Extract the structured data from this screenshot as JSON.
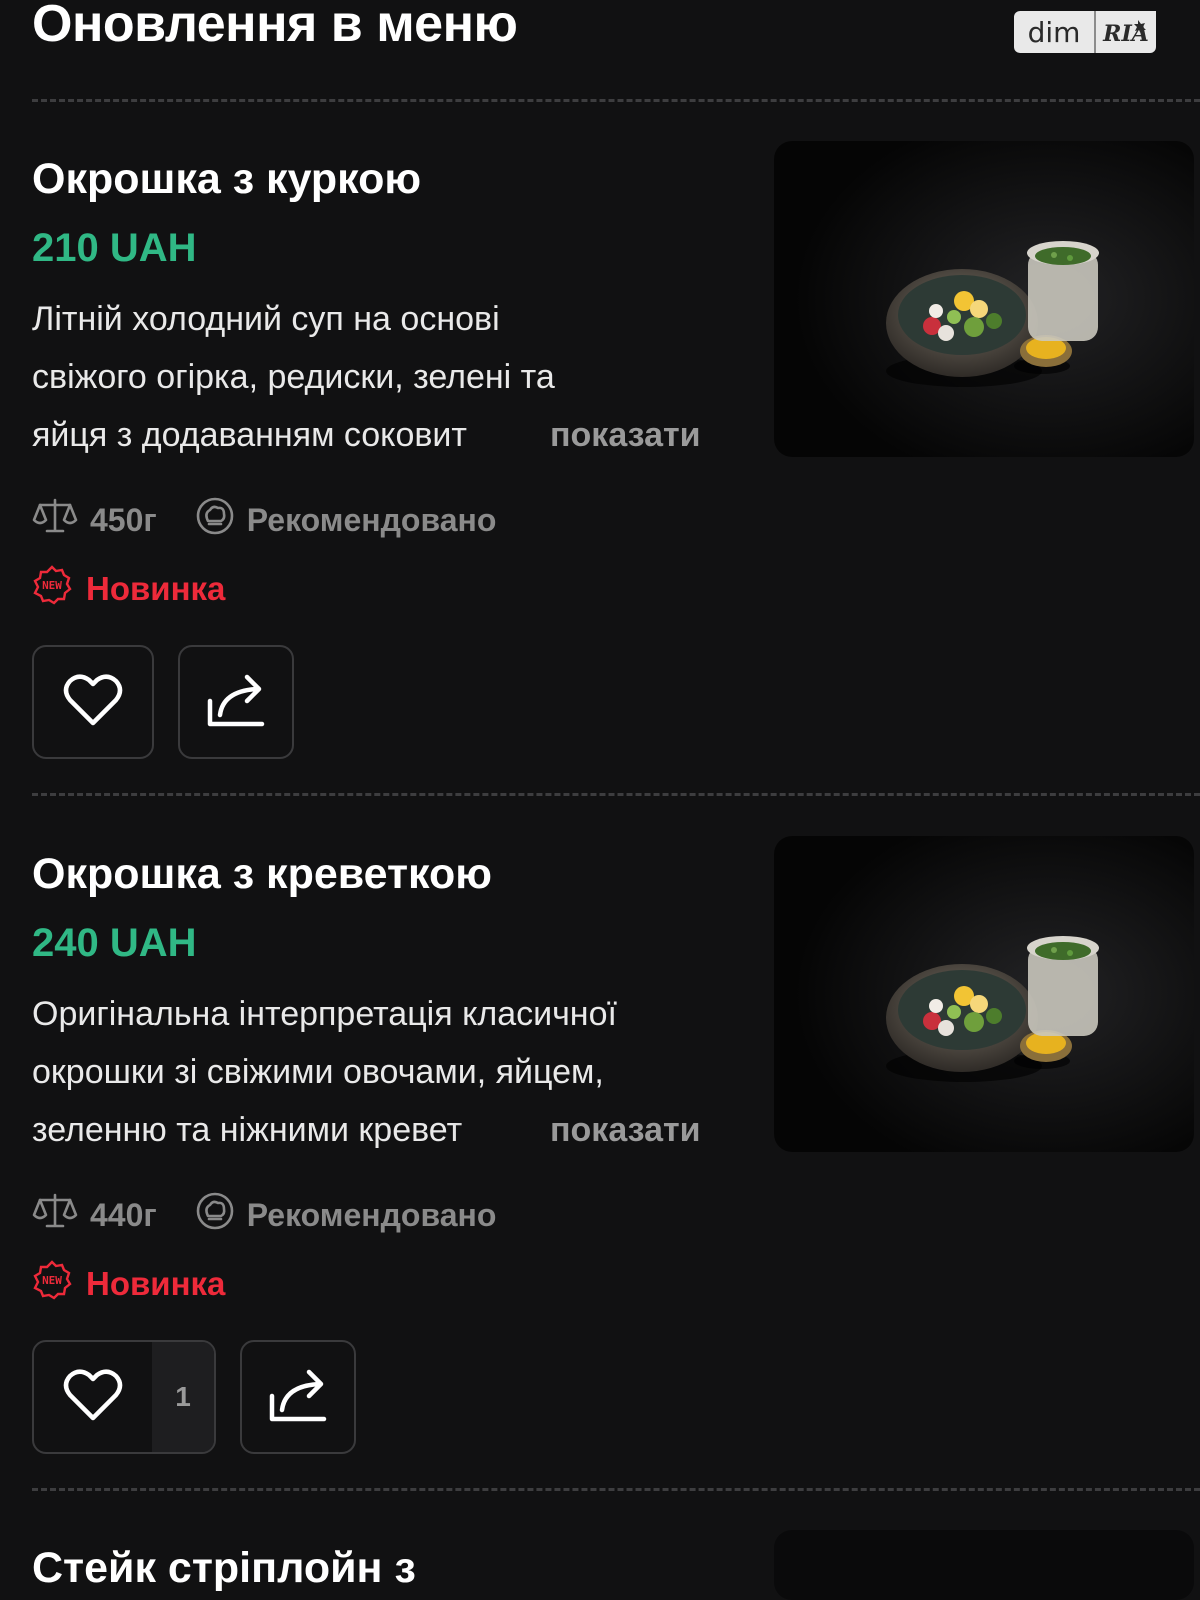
{
  "header": {
    "title": "Оновлення в меню",
    "watermark": {
      "left": "dim",
      "right": "RIA"
    }
  },
  "items": [
    {
      "title": "Окрошка з куркою",
      "price": "210 UAH",
      "description_lines": [
        "Літній холодний суп на основі",
        "свіжого огірка, редиски, зелені та",
        "яйця з додаванням соковит"
      ],
      "show_more": "показати",
      "weight": "450г",
      "recommended": "Рекомендовано",
      "badge": "Новинка",
      "likes": ""
    },
    {
      "title": "Окрошка з креветкою",
      "price": "240 UAH",
      "description_lines": [
        "Оригінальна інтерпретація класичної",
        "окрошки зі свіжими овочами, яйцем,",
        "зеленню та ніжними кревет"
      ],
      "show_more": "показати",
      "weight": "440г",
      "recommended": "Рекомендовано",
      "badge": "Новинка",
      "likes": "1"
    },
    {
      "title": "Стейк стріплойн з"
    }
  ],
  "icons": {
    "weight": "scale-icon",
    "recommended": "chef-hat-icon",
    "badge": "new-badge-icon",
    "like": "heart-icon",
    "share": "share-icon"
  },
  "colors": {
    "background": "#111112",
    "price": "#30b885",
    "badge": "#ee2a3a",
    "muted": "#8a8a8a"
  }
}
